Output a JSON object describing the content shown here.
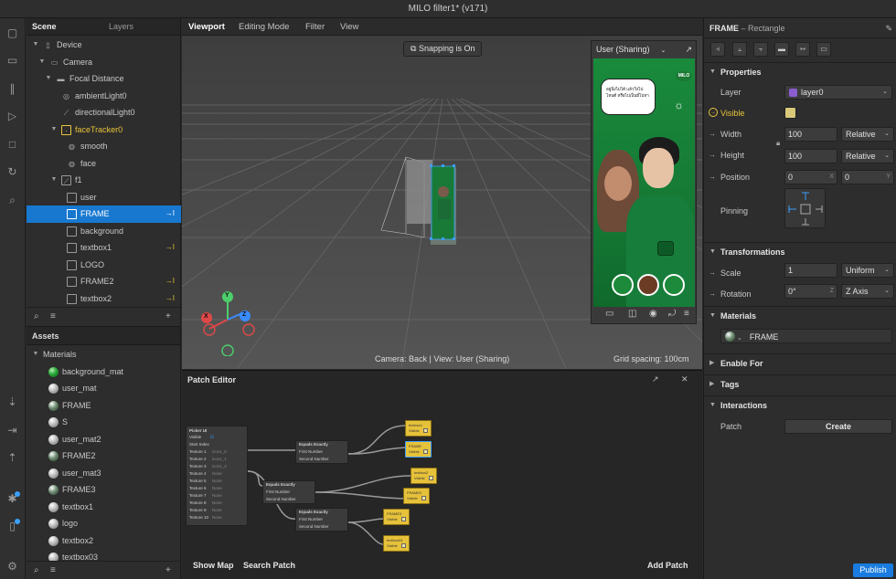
{
  "window": {
    "title": "MILO filter1* (v171)"
  },
  "colors": {
    "accent": "#1878d0",
    "link": "#e8c43a",
    "publish": "#1a7ce0",
    "layer_chip": "#8a5cd0"
  },
  "rail_icons": [
    "scene-icon",
    "video-icon",
    "library-icon",
    "play-icon",
    "stop-icon",
    "refresh-icon",
    "search-icon",
    "import-icon",
    "export-icon",
    "upload-icon",
    "bug-icon",
    "device-icon",
    "settings-icon"
  ],
  "scene": {
    "tabs": [
      "Scene",
      "Layers"
    ],
    "items": [
      {
        "label": "Device",
        "icon": "device"
      },
      {
        "label": "Camera",
        "icon": "camera"
      },
      {
        "label": "Focal Distance",
        "icon": "ruler"
      },
      {
        "label": "ambientLight0",
        "icon": "light"
      },
      {
        "label": "directionalLight0",
        "icon": "dirlight"
      },
      {
        "label": "faceTracker0",
        "icon": "face-tracker"
      },
      {
        "label": "smooth",
        "icon": "mesh"
      },
      {
        "label": "face",
        "icon": "mesh"
      },
      {
        "label": "f1",
        "icon": "canvas"
      },
      {
        "label": "user",
        "icon": "rect"
      },
      {
        "label": "FRAME",
        "icon": "rect"
      },
      {
        "label": "background",
        "icon": "rect"
      },
      {
        "label": "textbox1",
        "icon": "rect"
      },
      {
        "label": "LOGO",
        "icon": "rect"
      },
      {
        "label": "FRAME2",
        "icon": "rect"
      },
      {
        "label": "textbox2",
        "icon": "rect"
      }
    ],
    "footer": {
      "search": "⌕",
      "filter": "≡",
      "add": "+"
    }
  },
  "assets": {
    "title": "Assets",
    "group": "Materials",
    "items": [
      "background_mat",
      "user_mat",
      "FRAME",
      "S",
      "user_mat2",
      "FRAME2",
      "user_mat3",
      "FRAME3",
      "textbox1",
      "logo",
      "textbox2",
      "textbox03"
    ],
    "footer": {
      "search": "⌕",
      "filter": "≡",
      "add": "+"
    }
  },
  "viewport": {
    "tabs": [
      "Viewport",
      "Editing Mode",
      "Filter",
      "View"
    ],
    "snapping": "Snapping is On",
    "camera_info": "Camera: Back | View: User (Sharing)",
    "grid_spacing": "Grid spacing: 100cm",
    "gizmo": {
      "y": "Y",
      "x": "X",
      "z": "Z"
    },
    "preview": {
      "device": "User (Sharing)",
      "caption": "อยู่นิ่งไม่ได้ แล้ววิ่งไปไหนดี หรือไปเป็นมี่ไปหา",
      "brand": "MILO",
      "toolbar": [
        "record-icon",
        "capture-icon",
        "pin-icon",
        "rotate-icon",
        "menu-icon"
      ]
    }
  },
  "patch_editor": {
    "title": "Patch Editor",
    "show_map": "Show Map",
    "search_patch": "Search Patch",
    "add_patch": "Add Patch",
    "picker": {
      "title": "Picker UI",
      "rows": [
        "Visible",
        "Start Index",
        "Texture 1",
        "Texture 2",
        "Texture 3",
        "Texture 4",
        "Texture 5",
        "Texture 6",
        "Texture 7",
        "Texture 8",
        "Texture 9",
        "Texture 10"
      ],
      "values": [
        "",
        "",
        "icon1_0",
        "icon1_1",
        "icon1_2",
        "None",
        "None",
        "None",
        "None",
        "None",
        "None",
        "None"
      ]
    },
    "equals": [
      {
        "title": "Equals Exactly",
        "rows": [
          "First Number",
          "Second Number"
        ]
      },
      {
        "title": "Equals Exactly",
        "rows": [
          "First Number",
          "Second Number"
        ]
      },
      {
        "title": "Equals Exactly",
        "rows": [
          "First Number",
          "Second Number"
        ]
      }
    ],
    "outputs": [
      {
        "title": "textbox1",
        "row": "Visible"
      },
      {
        "title": "FRAME",
        "row": "Visible"
      },
      {
        "title": "textbox2",
        "row": "Visible"
      },
      {
        "title": "FRAME2",
        "row": "Visible"
      },
      {
        "title": "FRAME3",
        "row": "Visible"
      },
      {
        "title": "textbox03",
        "row": "Visible"
      }
    ]
  },
  "inspector": {
    "name": "FRAME",
    "type": "– Rectangle",
    "sections": {
      "properties": "Properties",
      "transformations": "Transformations",
      "materials": "Materials",
      "enable_for": "Enable For",
      "tags": "Tags",
      "interactions": "Interactions"
    },
    "layer": {
      "label": "Layer",
      "value": "layer0"
    },
    "visible": {
      "label": "Visible"
    },
    "width": {
      "label": "Width",
      "value": "100",
      "mode": "Relative"
    },
    "height": {
      "label": "Height",
      "value": "100",
      "mode": "Relative"
    },
    "position": {
      "label": "Position",
      "x": "0",
      "y": "0",
      "sx": "X",
      "sy": "Y"
    },
    "pinning": {
      "label": "Pinning"
    },
    "scale": {
      "label": "Scale",
      "value": "1",
      "mode": "Uniform"
    },
    "rotation": {
      "label": "Rotation",
      "value": "0°",
      "sfx": "Z",
      "axis": "Z Axis"
    },
    "material": {
      "value": "FRAME"
    },
    "patch": {
      "label": "Patch",
      "button": "Create"
    },
    "publish": "Publish"
  }
}
